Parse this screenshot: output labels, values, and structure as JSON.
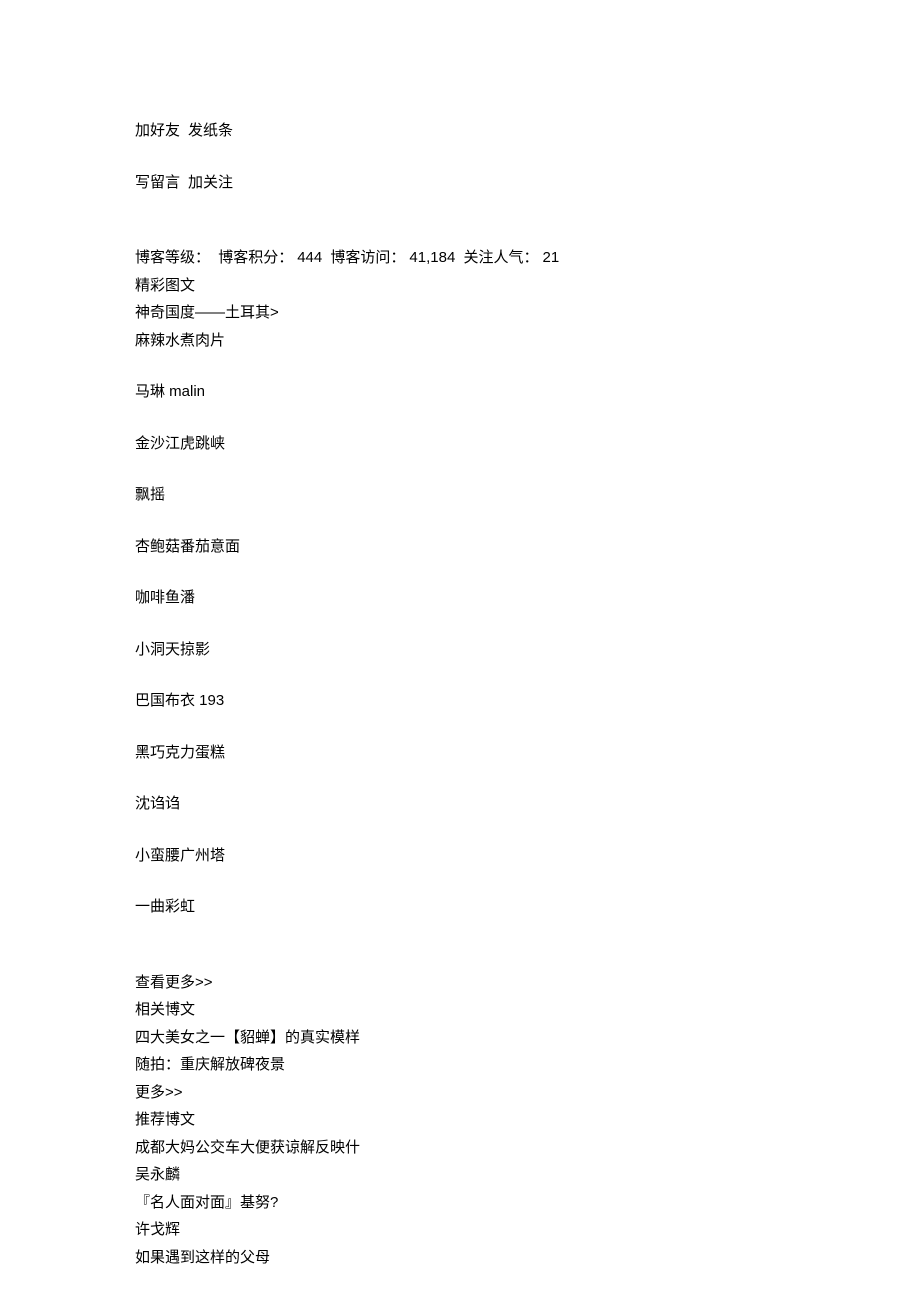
{
  "actions": {
    "add_friend": "加好友",
    "send_note": "发纸条",
    "leave_message": "写留言",
    "follow": "加关注"
  },
  "stats": {
    "level_label": "博客等级：",
    "points_label": "博客积分：",
    "points_value": "444",
    "visits_label": "博客访问：",
    "visits_value": "41,184",
    "followers_label": "关注人气：",
    "followers_value": "21"
  },
  "featured": {
    "title": "精彩图文",
    "items": [
      "神奇国度——土耳其>",
      "麻辣水煮肉片",
      "马琳 malin",
      "金沙江虎跳峡",
      "飘摇",
      "杏鲍菇番茄意面",
      "咖啡鱼潘",
      "小洞天掠影",
      "巴国布衣 193",
      "黑巧克力蛋糕",
      "沈诌诌",
      "小蛮腰广州塔",
      "一曲彩虹"
    ]
  },
  "view_more": "查看更多>>",
  "related": {
    "title": "相关博文",
    "items": [
      "四大美女之一【貂蝉】的真实模样",
      "随拍：重庆解放碑夜景"
    ]
  },
  "more_link": "更多>>",
  "recommended": {
    "title": "推荐博文",
    "items": [
      "成都大妈公交车大便获谅解反映什",
      "吴永麟",
      "『名人面对面』基努?",
      "许戈辉",
      "如果遇到这样的父母"
    ]
  }
}
